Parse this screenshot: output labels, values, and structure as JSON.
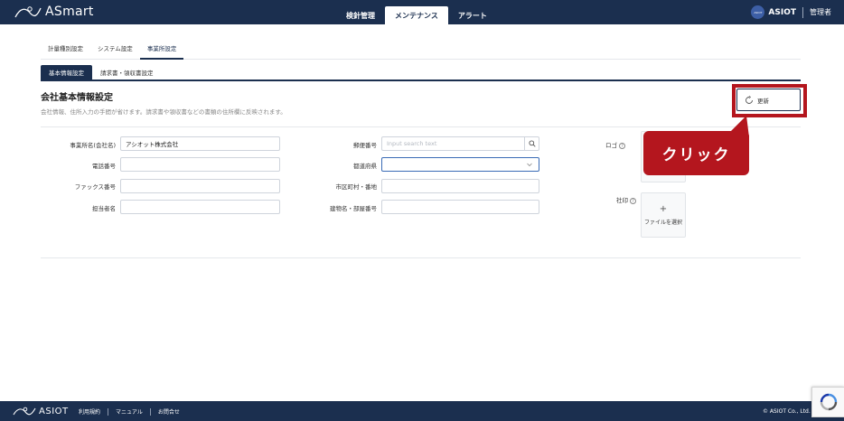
{
  "header": {
    "brand": "ASmart",
    "nav": [
      "検針管理",
      "メンテナンス",
      "アラート"
    ],
    "active_nav": "メンテナンス",
    "company": "ASIOT",
    "badge": "ASIOT",
    "user": "管理者"
  },
  "subnav": {
    "items": [
      "計量種別設定",
      "システム設定",
      "事業所設定"
    ],
    "active": "事業所設定"
  },
  "tabs": {
    "items": [
      "基本情報設定",
      "請求書・領収書設定"
    ],
    "active": "基本情報設定"
  },
  "section": {
    "title": "会社基本情報設定",
    "description": "会社情報、住所入力の手間が省けます。請求書や領収書などの書類の住所欄に反映されます。",
    "update_label": "更新"
  },
  "form": {
    "office_name_label": "事業所名(会社名)",
    "office_name_value": "アシオット株式会社",
    "phone_label": "電話番号",
    "phone_value": "",
    "fax_label": "ファックス番号",
    "fax_value": "",
    "contact_label": "担当者名",
    "contact_value": "",
    "postal_label": "郵便番号",
    "postal_placeholder": "Input search text",
    "prefecture_label": "都道府県",
    "prefecture_value": "",
    "city_label": "市区町村・番地",
    "city_value": "",
    "building_label": "建物名・部屋番号",
    "building_value": "",
    "logo_label": "ロゴ",
    "seal_label": "社印",
    "upload_label": "ファイルを選択",
    "help_symbol": "?"
  },
  "callout": {
    "text": "クリック",
    "color": "#b4161e"
  },
  "footer": {
    "brand": "ASIOT",
    "links": [
      "利用規約",
      "マニュアル",
      "お問合せ"
    ],
    "copyright": "© ASIOT Co., Ltd."
  },
  "colors": {
    "navy": "#1b2f4f",
    "accent_red": "#b4161e"
  }
}
